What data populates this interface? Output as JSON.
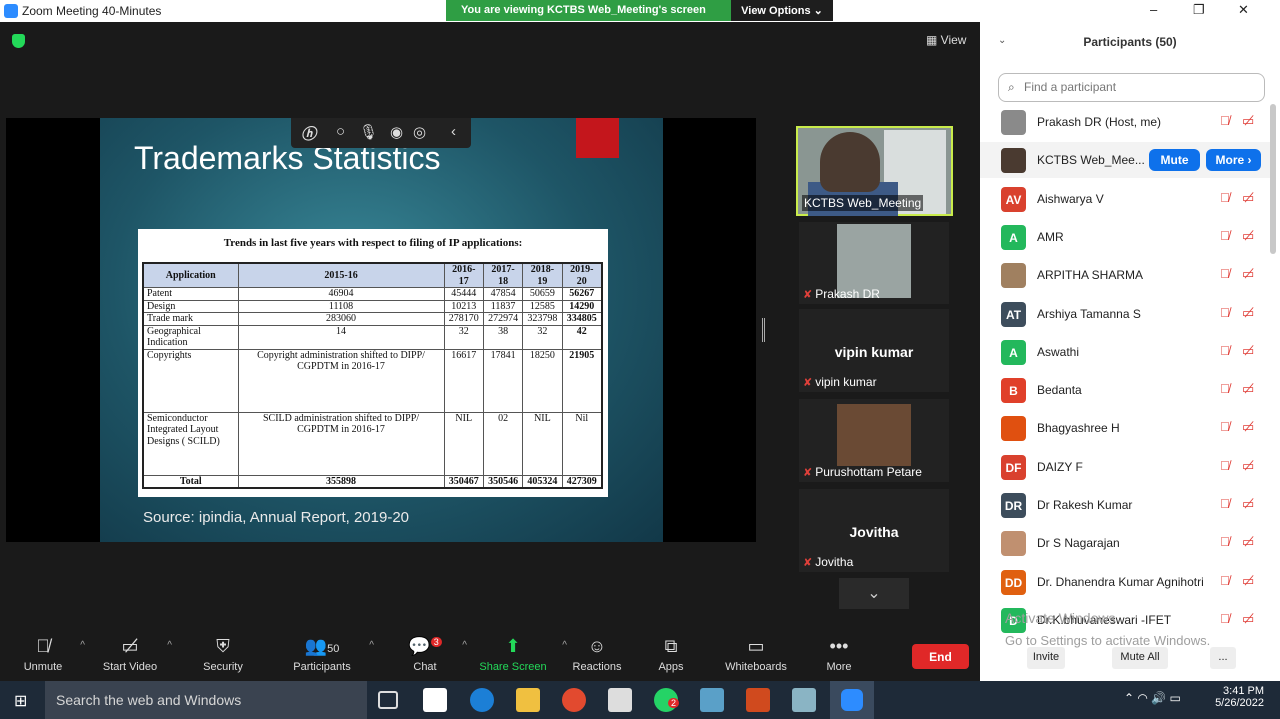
{
  "window": {
    "title": "Zoom Meeting 40-Minutes",
    "controls": [
      "–",
      "❐",
      "✕"
    ]
  },
  "banner": {
    "message": "You are viewing KCTBS Web_Meeting's screen",
    "view_options": "View Options ⌄"
  },
  "view_button": "View",
  "slide": {
    "title": "Trademarks Statistics",
    "table_caption": "Trends in last five years with respect to filing of IP applications:",
    "headers": [
      "Application",
      "2015-16",
      "2016-17",
      "2017-18",
      "2018-19",
      "2019-20"
    ],
    "rows": [
      {
        "app": "Patent",
        "v": [
          "46904",
          "45444",
          "47854",
          "50659",
          "56267"
        ]
      },
      {
        "app": "Design",
        "v": [
          "11108",
          "10213",
          "11837",
          "12585",
          "14290"
        ]
      },
      {
        "app": "Trade mark",
        "v": [
          "283060",
          "278170",
          "272974",
          "323798",
          "334805"
        ]
      },
      {
        "app": "Geographical Indication",
        "v": [
          "14",
          "32",
          "38",
          "32",
          "42"
        ]
      },
      {
        "app": "Copyrights",
        "v": [
          "Copyright administration shifted to DIPP/ CGPDTM in 2016-17",
          "16617",
          "17841",
          "18250",
          "21905"
        ]
      },
      {
        "app": "Semiconductor Integrated Layout Designs ( SCILD)",
        "v": [
          "SCILD administration shifted to DIPP/ CGPDTM in 2016-17",
          "NIL",
          "02",
          "NIL",
          "Nil"
        ]
      },
      {
        "app": "Total",
        "v": [
          "355898",
          "350467",
          "350546",
          "405324",
          "427309"
        ]
      }
    ],
    "source": "Source: ipindia, Annual Report, 2019-20"
  },
  "video_tiles": [
    {
      "name": "KCTBS Web_Meeting"
    },
    {
      "name": "Prakash DR"
    },
    {
      "name": "vipin kumar",
      "big": "vipin kumar"
    },
    {
      "name": "Purushottam Petare"
    },
    {
      "name": "Jovitha",
      "big": "Jovitha"
    }
  ],
  "toolbar": {
    "unmute": "Unmute",
    "start_video": "Start Video",
    "security": "Security",
    "participants": "Participants",
    "participants_count": "50",
    "chat": "Chat",
    "chat_badge": "3",
    "share_screen": "Share Screen",
    "reactions": "Reactions",
    "apps": "Apps",
    "whiteboards": "Whiteboards",
    "more": "More",
    "end": "End"
  },
  "panel": {
    "title": "Participants (50)",
    "search_placeholder": "Find a participant",
    "mute_btn": "Mute",
    "more_btn": "More ›",
    "invite": "Invite",
    "mute_all": "Mute All",
    "ellipsis": "...",
    "participants": [
      {
        "name": "Prakash DR (Host, me)",
        "initials": "",
        "color": "#8a8a8a"
      },
      {
        "name": "KCTBS Web_Mee...",
        "initials": "",
        "color": "#4a3a30"
      },
      {
        "name": "Aishwarya V",
        "initials": "AV",
        "color": "#d9412e"
      },
      {
        "name": "AMR",
        "initials": "A",
        "color": "#23b85c"
      },
      {
        "name": "ARPITHA SHARMA",
        "initials": "",
        "color": "#a08060"
      },
      {
        "name": "Arshiya Tamanna S",
        "initials": "AT",
        "color": "#3d4d5c"
      },
      {
        "name": "Aswathi",
        "initials": "A",
        "color": "#23b85c"
      },
      {
        "name": "Bedanta",
        "initials": "B",
        "color": "#e0402a"
      },
      {
        "name": "Bhagyashree H",
        "initials": "",
        "color": "#e05010"
      },
      {
        "name": "DAIZY F",
        "initials": "DF",
        "color": "#d9412e"
      },
      {
        "name": "Dr Rakesh Kumar",
        "initials": "DR",
        "color": "#3d4d5c"
      },
      {
        "name": "Dr S Nagarajan",
        "initials": "",
        "color": "#c09070"
      },
      {
        "name": "Dr. Dhanendra Kumar Agnihotri",
        "initials": "DD",
        "color": "#e06010"
      },
      {
        "name": "Dr.K.bhuvaneswari -IFET",
        "initials": "D",
        "color": "#23b85c"
      }
    ],
    "activate_line1": "Activate Windows",
    "activate_line2": "Go to Settings to activate Windows."
  },
  "taskbar": {
    "search": "Search the web and Windows",
    "time": "3:41 PM",
    "date": "5/26/2022",
    "whatsapp_badge": "2"
  },
  "colors": {
    "accent": "#0e71eb",
    "share_green": "#23d959",
    "end_red": "#e02828",
    "speaker_border": "#c9ec4b"
  }
}
